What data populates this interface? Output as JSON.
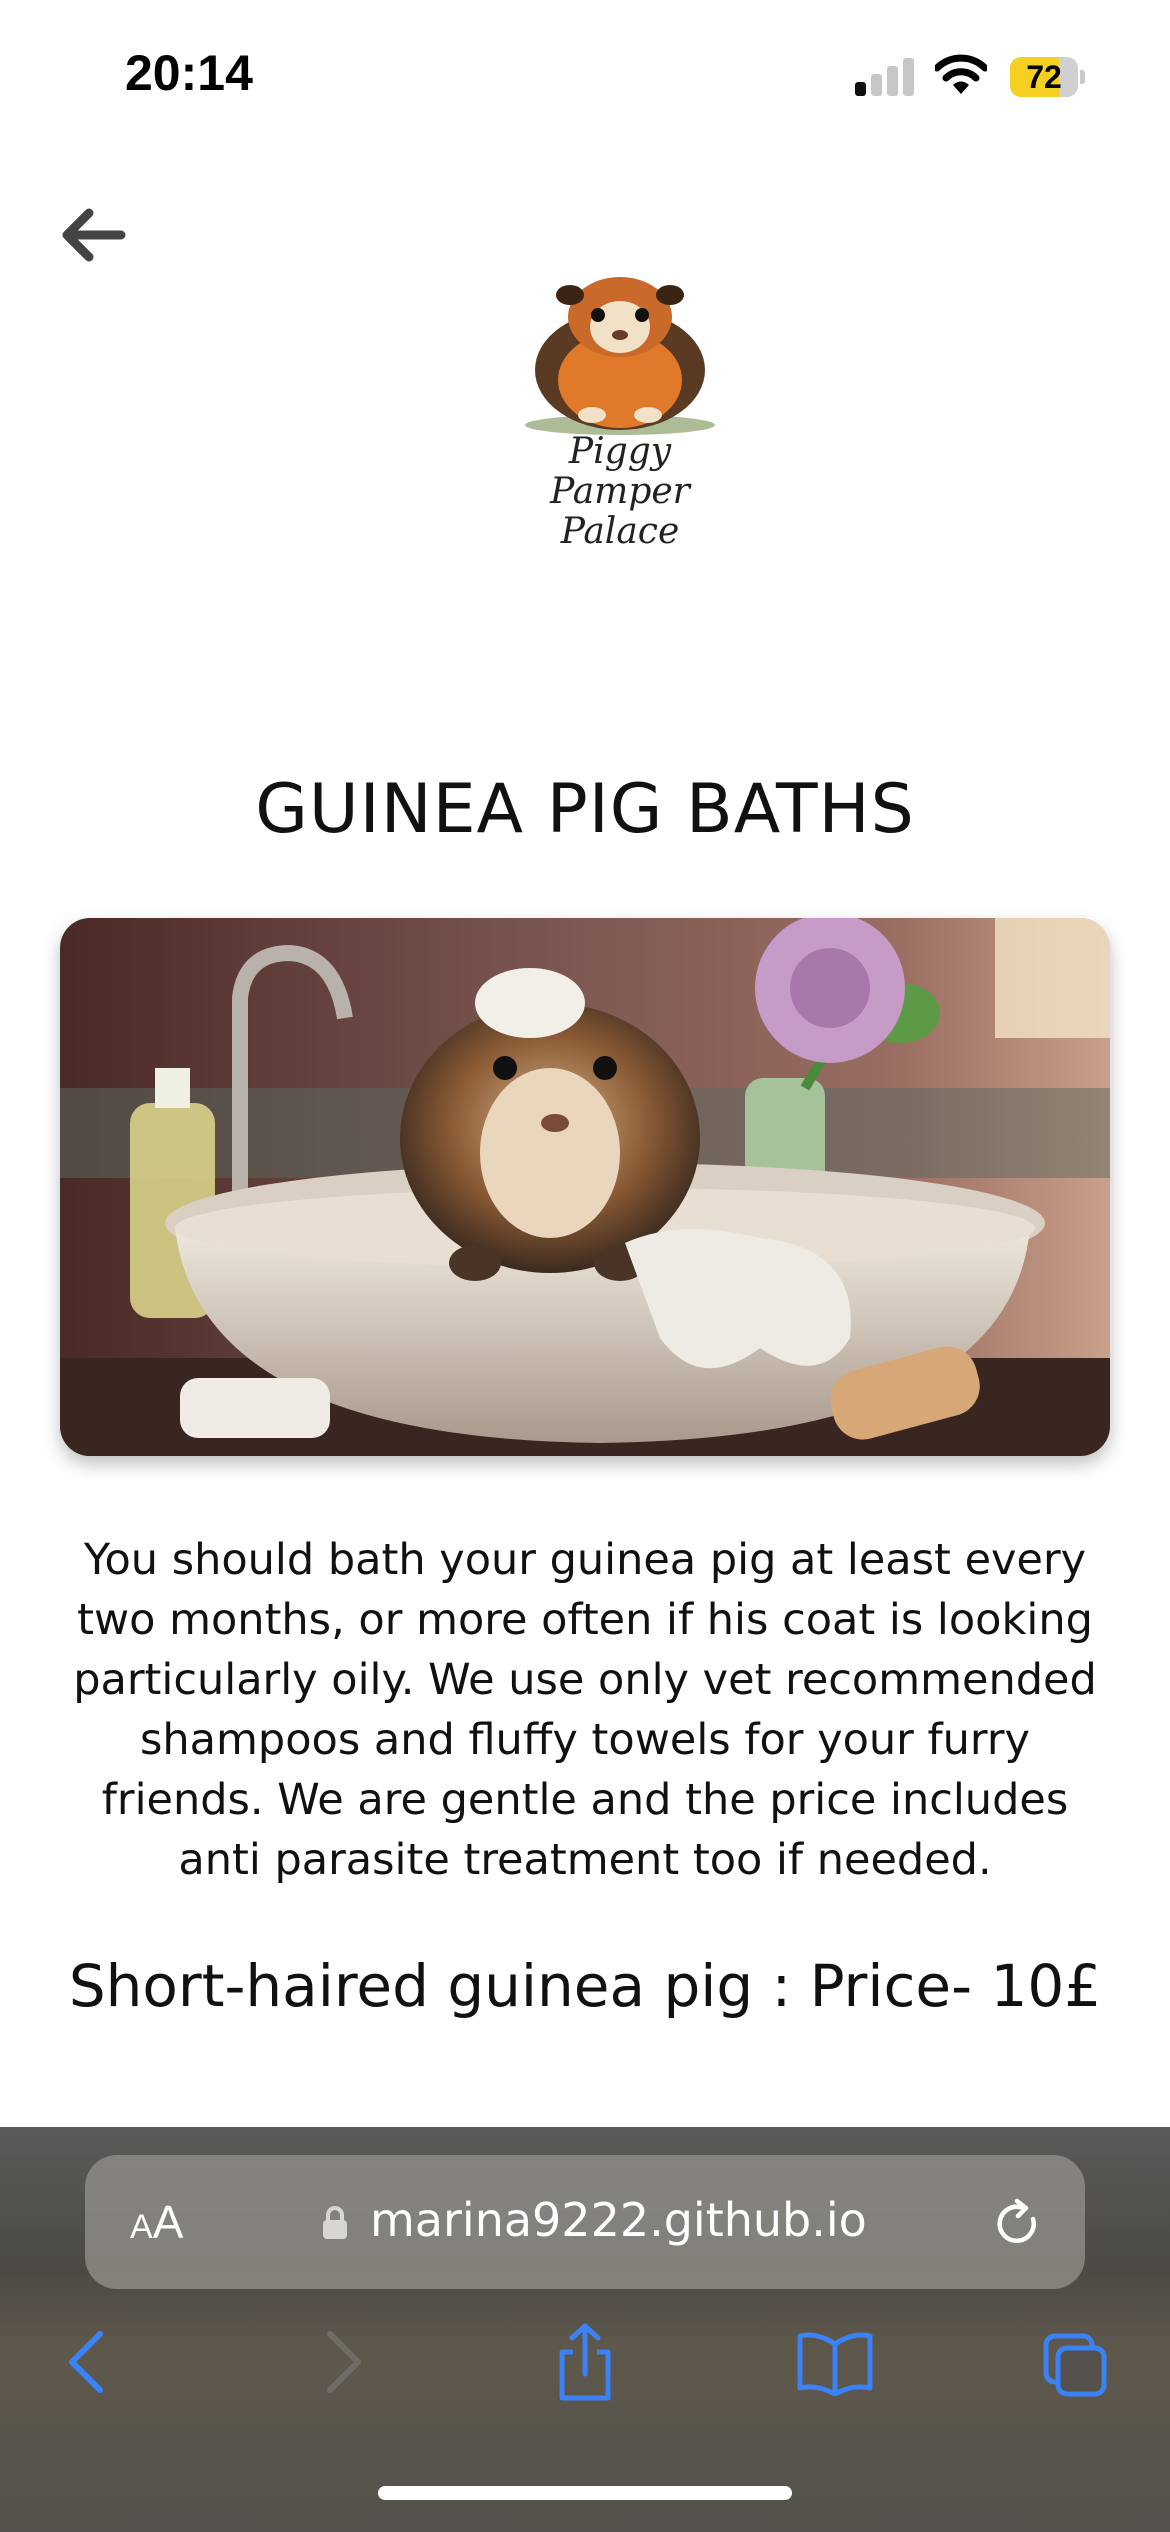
{
  "status_bar": {
    "time": "20:14",
    "battery_percent": "72",
    "battery_level": 0.72,
    "signal_bars_active": 1,
    "signal_bars_total": 4,
    "icons": [
      "cellular-signal-icon",
      "wifi-icon",
      "battery-icon"
    ]
  },
  "header": {
    "back_icon": "arrow-left-icon",
    "logo_text_line1": "Piggy Pamper",
    "logo_text_line2": "Palace"
  },
  "main": {
    "title": "GUINEA PIG BATHS",
    "description": "You should bath your guinea pig at least every two months, or more often if his coat is looking particularly oily. We use only vet recommended shampoos and fluffy towels for your furry friends. We are gentle and the price includes anti parasite treatment too if needed.",
    "price_line": "Short-haired guinea pig : Price- 10£"
  },
  "browser": {
    "text_size_label_small": "A",
    "text_size_label_big": "A",
    "url": "marina9222.github.io",
    "icons": [
      "lock-icon",
      "reload-icon",
      "chevron-left-icon",
      "chevron-right-icon",
      "share-icon",
      "bookmarks-icon",
      "tabs-icon"
    ],
    "accent_color": "#3b82f6"
  },
  "colors": {
    "background": "#ffffff",
    "text": "#111111",
    "browser_bar": "#55524d",
    "battery_fill": "#f5d020"
  }
}
